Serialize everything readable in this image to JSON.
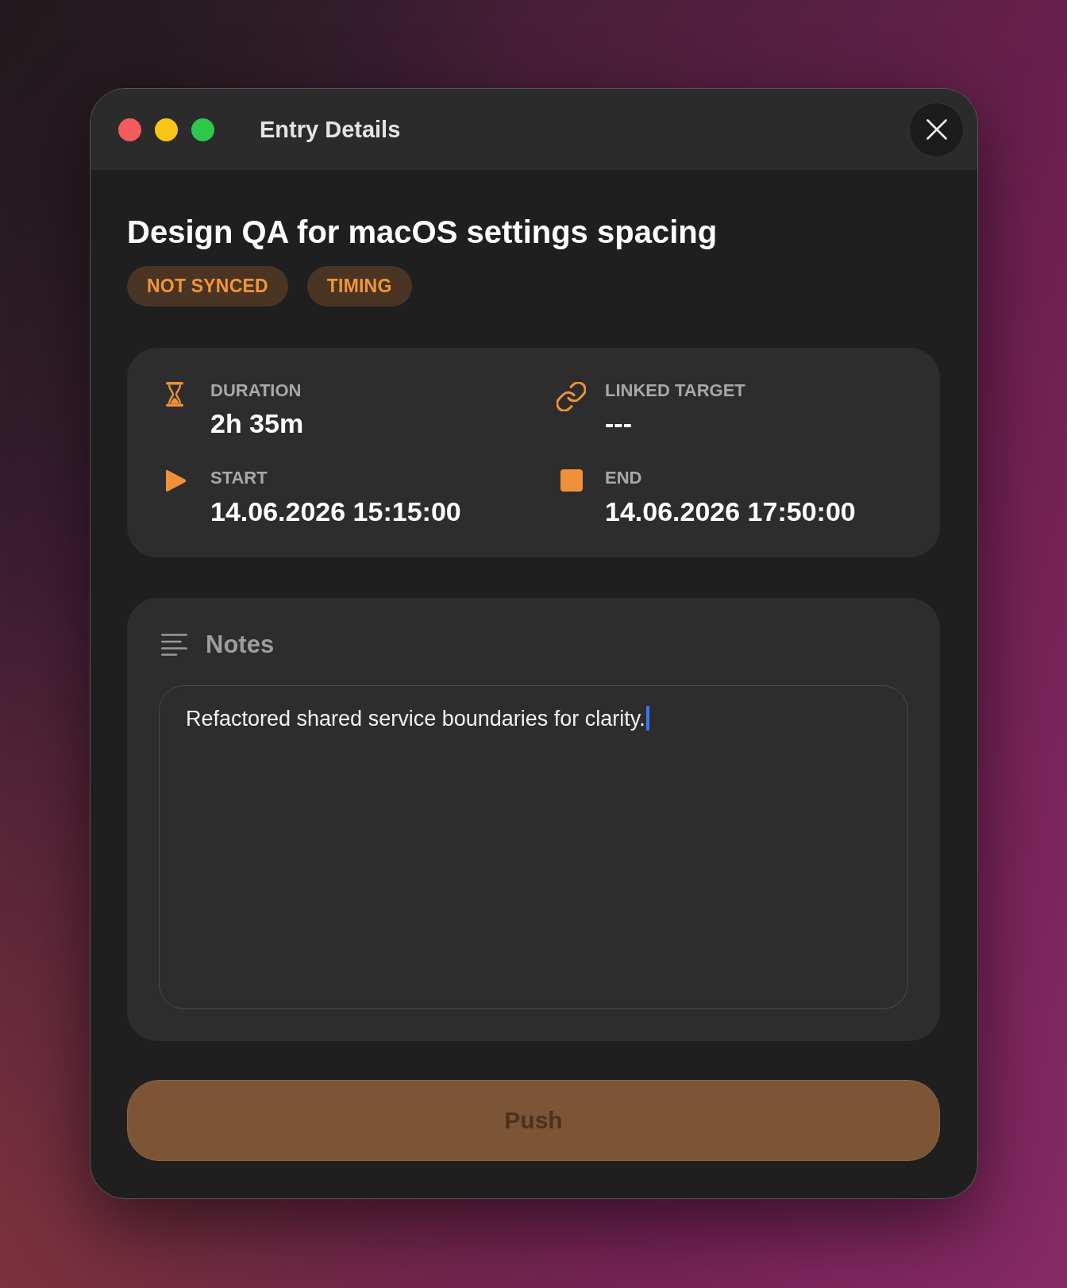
{
  "window": {
    "title": "Entry Details"
  },
  "entry": {
    "title": "Design QA for macOS settings spacing",
    "tags": [
      {
        "label": "NOT SYNCED"
      },
      {
        "label": "TIMING"
      }
    ]
  },
  "details": [
    {
      "kind": "duration",
      "label": "DURATION",
      "value": "2h 35m"
    },
    {
      "kind": "link",
      "label": "LINKED TARGET",
      "value": "---"
    },
    {
      "kind": "start",
      "label": "START",
      "value": "14.06.2026 15:15:00"
    },
    {
      "kind": "end",
      "label": "END",
      "value": "14.06.2026 17:50:00"
    }
  ],
  "notes": {
    "heading": "Notes",
    "value": "Refactored shared service boundaries for clarity.",
    "focused": true
  },
  "push_button": {
    "label": "Push",
    "disabled": true
  }
}
